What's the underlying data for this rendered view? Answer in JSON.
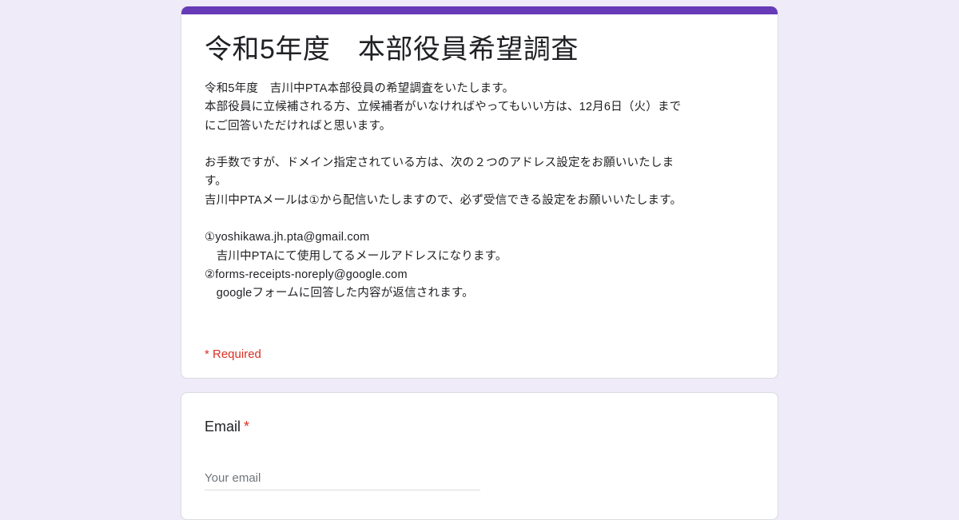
{
  "form": {
    "title": "令和5年度　本部役員希望調査",
    "description": [
      "令和5年度　吉川中PTA本部役員の希望調査をいたします。",
      "本部役員に立候補される方、立候補者がいなければやってもいい方は、12月6日（火）まで",
      "にご回答いただければと思います。",
      "",
      "お手数ですが、ドメイン指定されている方は、次の２つのアドレス設定をお願いいたしま",
      "す。",
      "吉川中PTAメールは①から配信いたしますので、必ず受信できる設定をお願いいたします。",
      "",
      "①yoshikawa.jh.pta@gmail.com",
      "　吉川中PTAにて使用してるメールアドレスになります。",
      "②forms-receipts-noreply@google.com",
      "　googleフォームに回答した内容が返信されます。"
    ],
    "required_note": "* Required",
    "accent_color": "#673ab7",
    "background_color": "#efebf9"
  },
  "email_question": {
    "label": "Email",
    "required_mark": "*",
    "placeholder": "Your email",
    "value": ""
  }
}
